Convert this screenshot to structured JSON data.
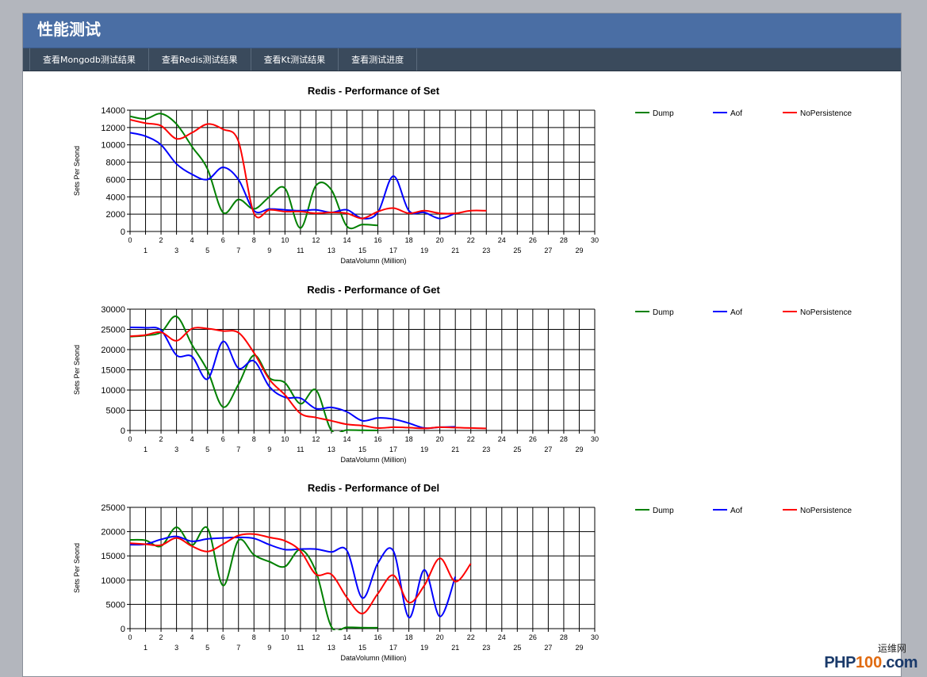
{
  "page": {
    "title": "性能测试"
  },
  "nav": {
    "items": [
      {
        "label": "查看Mongodb测试结果"
      },
      {
        "label": "查看Redis测试结果"
      },
      {
        "label": "查看Kt测试结果"
      },
      {
        "label": "查看测试进度"
      }
    ]
  },
  "watermark": {
    "small": "运维网",
    "main": "PHP",
    "num": "100",
    "suffix": ".com"
  },
  "chart_data": [
    {
      "type": "line",
      "title": "Redis - Performance of Set",
      "xlabel": "DataVolumn (Million)",
      "ylabel": "Sets Per Seond",
      "xlim": [
        0,
        30
      ],
      "ylim": [
        0,
        14000
      ],
      "yticks": [
        0,
        2000,
        4000,
        6000,
        8000,
        10000,
        12000,
        14000
      ],
      "grid": true,
      "legend_position": "top-right",
      "series": [
        {
          "name": "Dump",
          "color": "#008000",
          "x": [
            0,
            1,
            2,
            3,
            4,
            5,
            6,
            7,
            8,
            9,
            10,
            11,
            12,
            13,
            14,
            15,
            16
          ],
          "y": [
            13300,
            13000,
            13600,
            12400,
            9800,
            7200,
            2200,
            3700,
            2600,
            4000,
            5000,
            400,
            5300,
            4800,
            600,
            800,
            700
          ]
        },
        {
          "name": "Aof",
          "color": "#0000ff",
          "x": [
            0,
            1,
            2,
            3,
            4,
            5,
            6,
            7,
            8,
            9,
            10,
            11,
            12,
            13,
            14,
            15,
            16,
            17,
            18,
            19,
            20,
            21
          ],
          "y": [
            11400,
            11000,
            10000,
            7800,
            6600,
            6000,
            7400,
            6000,
            2400,
            2600,
            2500,
            2400,
            2500,
            2200,
            2500,
            1500,
            2200,
            6400,
            2400,
            2200,
            1500,
            2100
          ]
        },
        {
          "name": "NoPersistence",
          "color": "#ff0000",
          "x": [
            0,
            1,
            2,
            3,
            4,
            5,
            6,
            7,
            8,
            9,
            10,
            11,
            12,
            13,
            14,
            15,
            16,
            17,
            18,
            19,
            20,
            21,
            22,
            23
          ],
          "y": [
            12900,
            12500,
            12200,
            10700,
            11400,
            12400,
            11800,
            10400,
            2100,
            2500,
            2300,
            2300,
            2100,
            2200,
            2100,
            1500,
            2300,
            2700,
            2100,
            2400,
            2100,
            2100,
            2400,
            2400
          ]
        }
      ]
    },
    {
      "type": "line",
      "title": "Redis - Performance of Get",
      "xlabel": "DataVolumn (Million)",
      "ylabel": "Sets Per Seond",
      "xlim": [
        0,
        30
      ],
      "ylim": [
        0,
        30000
      ],
      "yticks": [
        0,
        5000,
        10000,
        15000,
        20000,
        25000,
        30000
      ],
      "grid": true,
      "legend_position": "top-right",
      "series": [
        {
          "name": "Dump",
          "color": "#008000",
          "x": [
            0,
            1,
            2,
            3,
            4,
            5,
            6,
            7,
            8,
            9,
            10,
            11,
            12,
            13,
            14,
            15,
            16
          ],
          "y": [
            23200,
            23500,
            24300,
            28200,
            21200,
            14800,
            5800,
            11400,
            18600,
            13000,
            11800,
            6600,
            10000,
            0,
            100,
            50,
            0
          ]
        },
        {
          "name": "Aof",
          "color": "#0000ff",
          "x": [
            0,
            1,
            2,
            3,
            4,
            5,
            6,
            7,
            8,
            9,
            10,
            11,
            12,
            13,
            14,
            15,
            16,
            17,
            18,
            19,
            20,
            21
          ],
          "y": [
            25500,
            25400,
            24800,
            18600,
            18300,
            12700,
            22000,
            15400,
            17200,
            10800,
            8200,
            8000,
            5400,
            5700,
            4600,
            2400,
            3100,
            2800,
            1800,
            600,
            800,
            900
          ]
        },
        {
          "name": "NoPersistence",
          "color": "#ff0000",
          "x": [
            0,
            1,
            2,
            3,
            4,
            5,
            6,
            7,
            8,
            9,
            10,
            11,
            12,
            13,
            14,
            15,
            16,
            17,
            18,
            19,
            20,
            21,
            22,
            23
          ],
          "y": [
            23300,
            23600,
            24300,
            22200,
            25200,
            25200,
            24600,
            24200,
            19200,
            12600,
            8800,
            4200,
            3200,
            2400,
            1500,
            1200,
            600,
            800,
            700,
            500,
            800,
            700,
            600,
            500
          ]
        }
      ]
    },
    {
      "type": "line",
      "title": "Redis - Performance of Del",
      "xlabel": "DataVolumn (Million)",
      "ylabel": "Sets Per Seond",
      "xlim": [
        0,
        30
      ],
      "ylim": [
        0,
        25000
      ],
      "yticks": [
        0,
        5000,
        10000,
        15000,
        20000,
        25000
      ],
      "grid": true,
      "legend_position": "top-right",
      "series": [
        {
          "name": "Dump",
          "color": "#008000",
          "x": [
            0,
            1,
            2,
            3,
            4,
            5,
            6,
            7,
            8,
            9,
            10,
            11,
            12,
            13,
            14,
            15,
            16
          ],
          "y": [
            18300,
            18200,
            17000,
            20900,
            17200,
            20700,
            8900,
            18200,
            15200,
            13800,
            12800,
            16300,
            11800,
            400,
            300,
            200,
            200
          ]
        },
        {
          "name": "Aof",
          "color": "#0000ff",
          "x": [
            0,
            1,
            2,
            3,
            4,
            5,
            6,
            7,
            8,
            9,
            10,
            11,
            12,
            13,
            14,
            15,
            16,
            17,
            18,
            19,
            20,
            21
          ],
          "y": [
            17300,
            17400,
            18400,
            19000,
            18000,
            18500,
            18700,
            18800,
            18600,
            17300,
            16300,
            16400,
            16400,
            15800,
            16100,
            6300,
            13500,
            16000,
            2300,
            12100,
            2500,
            10700
          ]
        },
        {
          "name": "NoPersistence",
          "color": "#ff0000",
          "x": [
            0,
            1,
            2,
            3,
            4,
            5,
            6,
            7,
            8,
            9,
            10,
            11,
            12,
            13,
            14,
            15,
            16,
            17,
            18,
            19,
            20,
            21,
            22
          ],
          "y": [
            17600,
            17400,
            17200,
            18700,
            17000,
            15900,
            17400,
            19200,
            19500,
            18800,
            18100,
            16000,
            11200,
            11200,
            6400,
            3100,
            7200,
            11000,
            5400,
            8900,
            14500,
            9700,
            13400
          ]
        }
      ]
    }
  ]
}
